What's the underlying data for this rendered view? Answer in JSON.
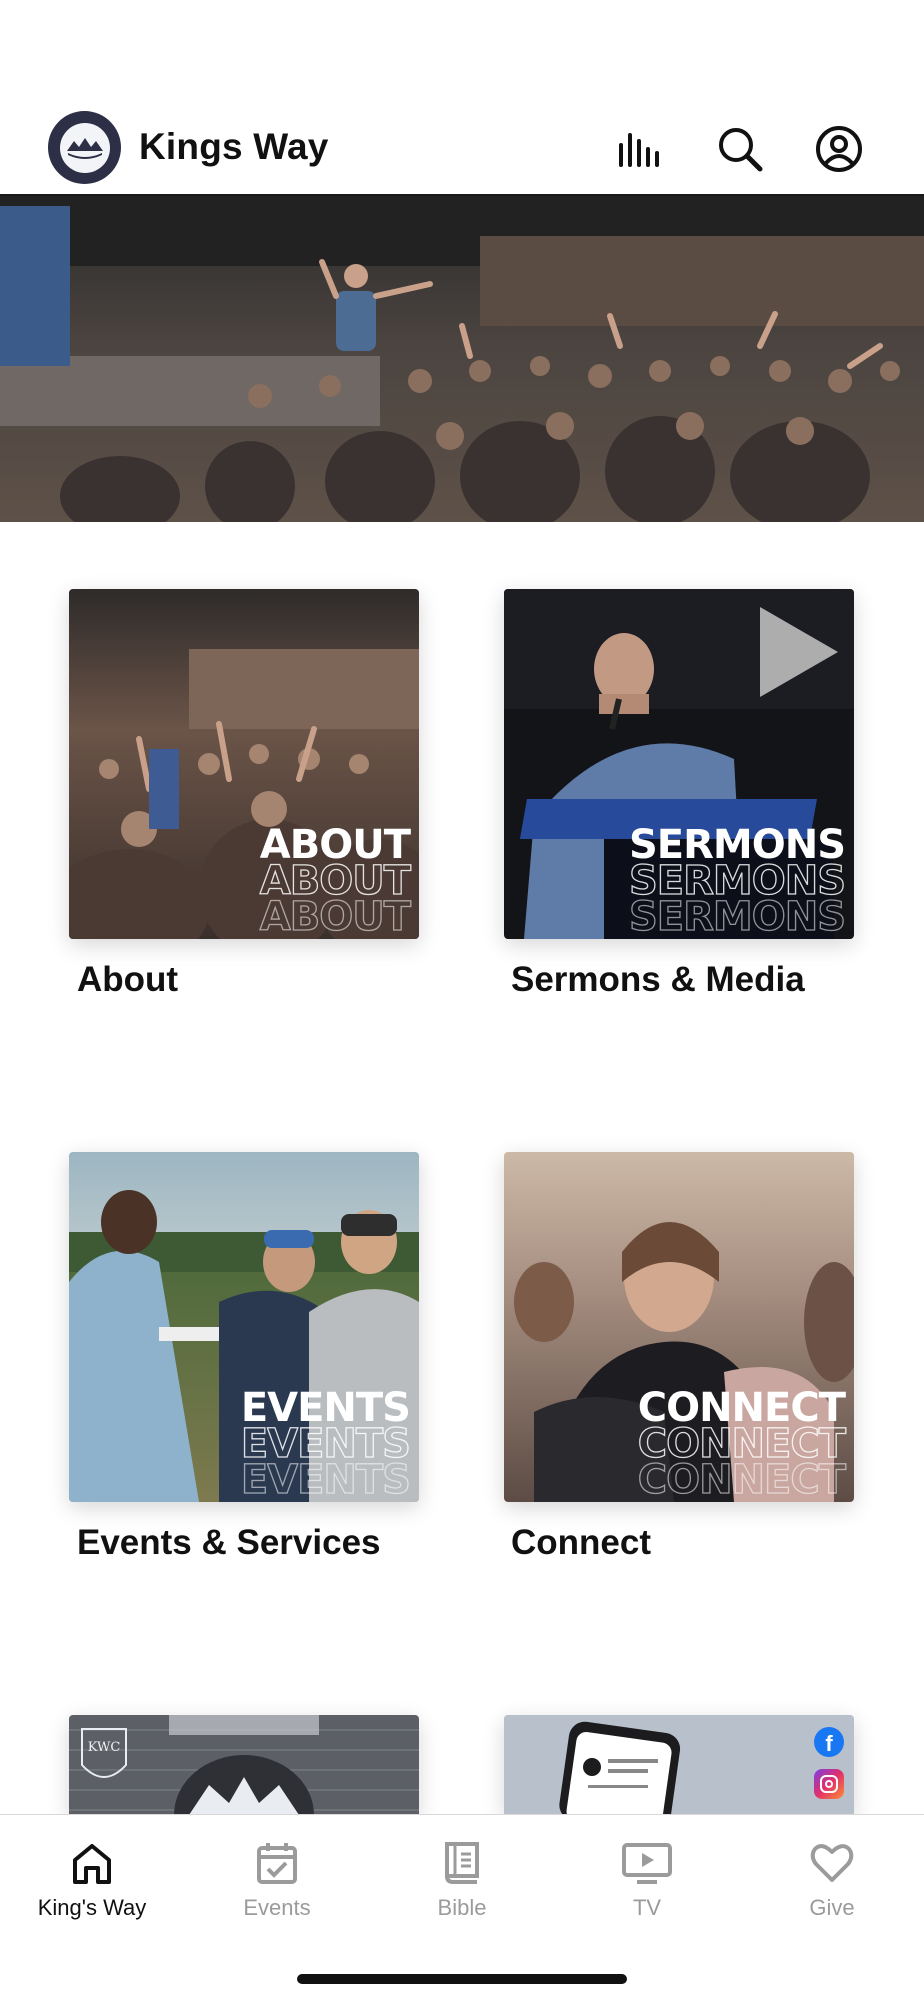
{
  "header": {
    "app_title": "Kings Way"
  },
  "tiles": [
    {
      "overlay": "ABOUT",
      "label": "About"
    },
    {
      "overlay": "SERMONS",
      "label": "Sermons & Media"
    },
    {
      "overlay": "EVENTS",
      "label": "Events & Services"
    },
    {
      "overlay": "CONNECT",
      "label": "Connect"
    }
  ],
  "partial_tiles": [
    {
      "badge": "KWC"
    },
    {
      "social": [
        "facebook",
        "instagram"
      ]
    }
  ],
  "tabbar": {
    "tabs": [
      {
        "label": "King's Way",
        "icon": "home-icon",
        "active": true
      },
      {
        "label": "Events",
        "icon": "calendar-icon",
        "active": false
      },
      {
        "label": "Bible",
        "icon": "book-icon",
        "active": false
      },
      {
        "label": "TV",
        "icon": "tv-icon",
        "active": false
      },
      {
        "label": "Give",
        "icon": "heart-icon",
        "active": false
      }
    ]
  },
  "colors": {
    "brand_navy": "#2c2f45",
    "active_tab": "#111111",
    "inactive_tab": "#9b9b9b"
  }
}
